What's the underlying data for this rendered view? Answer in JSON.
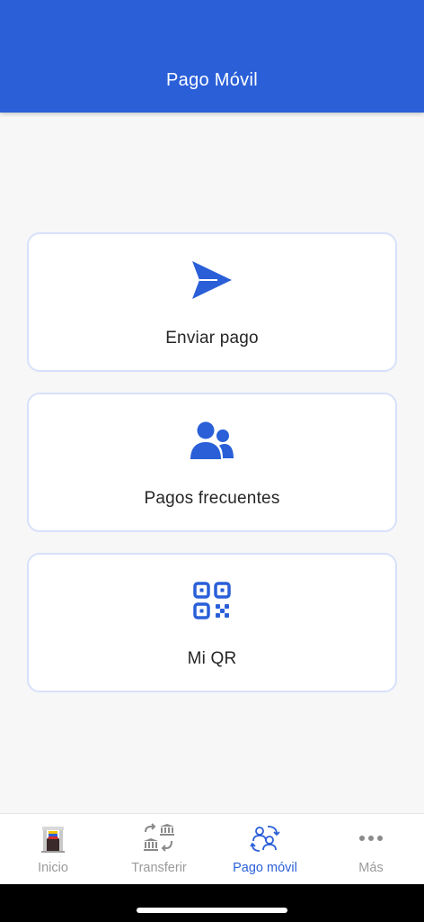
{
  "header": {
    "title": "Pago Móvil"
  },
  "cards": [
    {
      "label": "Enviar pago",
      "icon": "send-icon"
    },
    {
      "label": "Pagos frecuentes",
      "icon": "users-icon"
    },
    {
      "label": "Mi QR",
      "icon": "qr-code-icon"
    }
  ],
  "tabs": [
    {
      "label": "Inicio",
      "icon": "home-landmark-icon",
      "active": false
    },
    {
      "label": "Transferir",
      "icon": "bank-transfer-icon",
      "active": false
    },
    {
      "label": "Pago móvil",
      "icon": "mobile-payment-icon",
      "active": true
    },
    {
      "label": "Más",
      "icon": "more-dots-icon",
      "active": false
    }
  ],
  "colors": {
    "primary": "#2a5fd8",
    "background": "#f7f7f7",
    "card_border": "#d8e1fb",
    "inactive": "#9a9a9a"
  }
}
